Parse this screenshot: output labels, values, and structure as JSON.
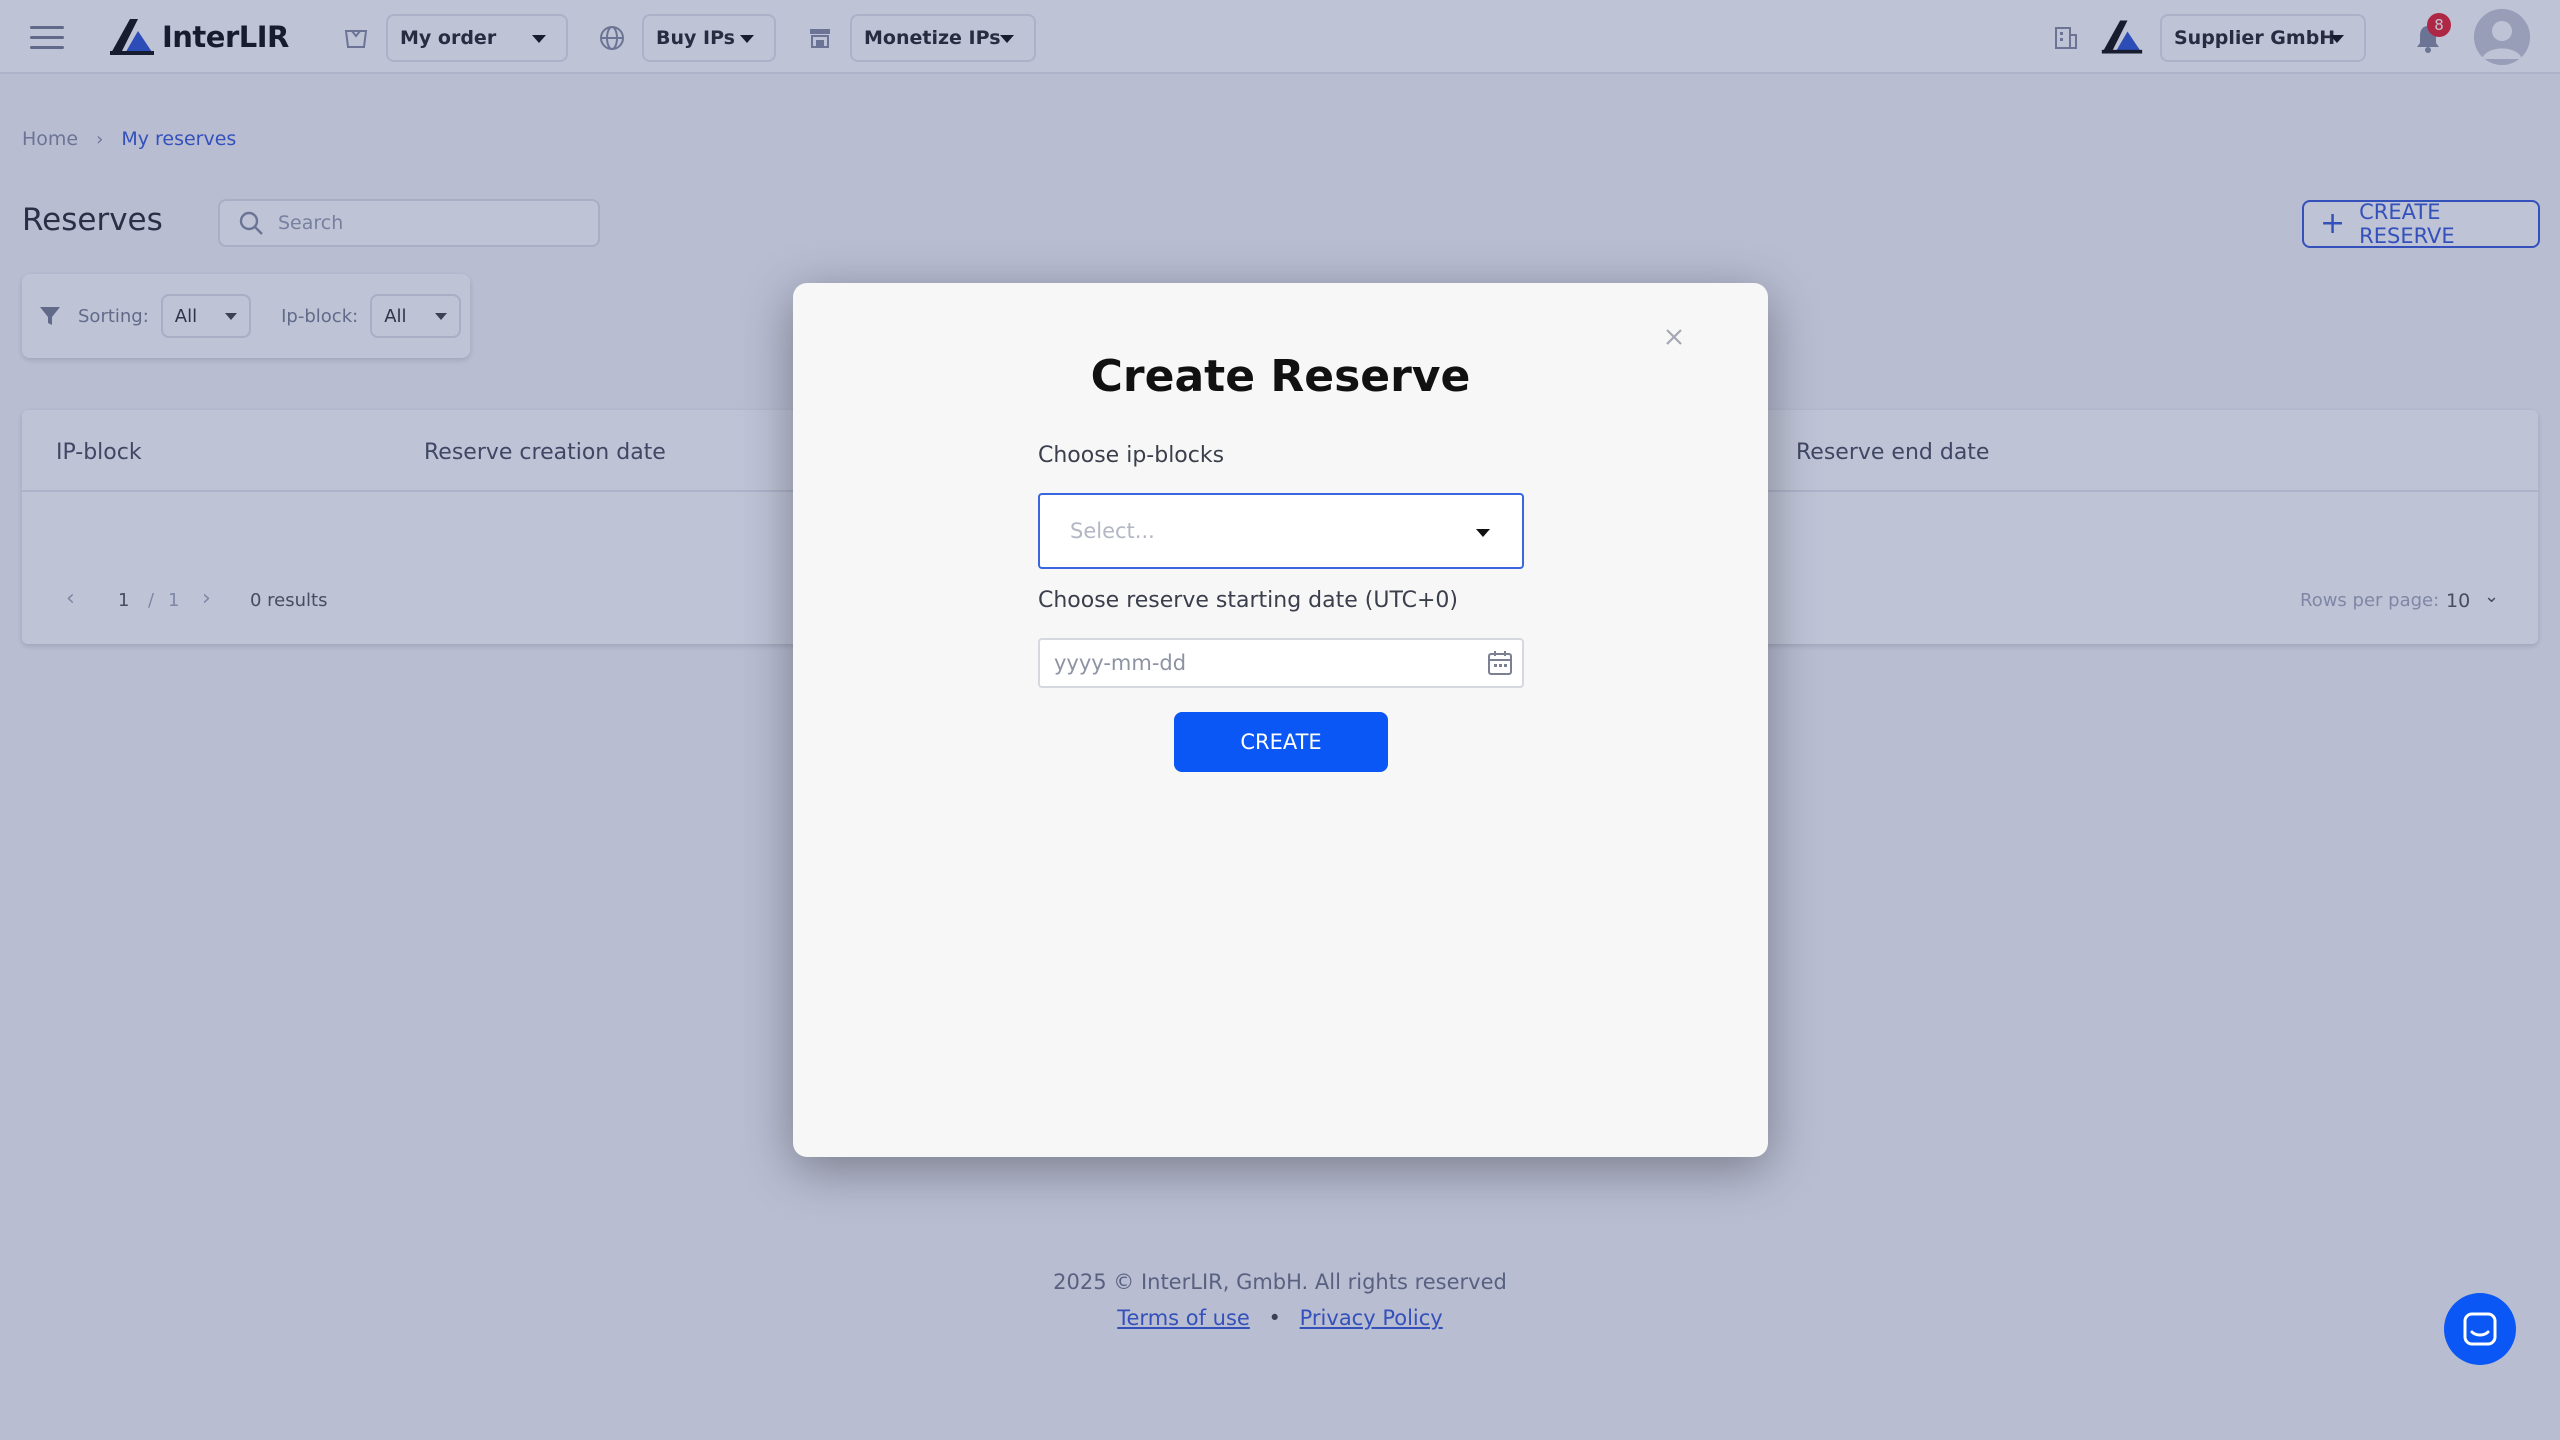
{
  "topbar": {
    "logo_text": "InterLIR",
    "nav": [
      {
        "label": "My order"
      },
      {
        "label": "Buy IPs"
      },
      {
        "label": "Monetize IPs"
      }
    ],
    "company": "Supplier GmbH",
    "notifications_count": "8"
  },
  "breadcrumb": {
    "home": "Home",
    "current": "My reserves"
  },
  "page": {
    "title": "Reserves",
    "search_placeholder": "Search",
    "create_button": "CREATE RESERVE",
    "filters": {
      "sorting_label": "Sorting:",
      "sorting_value": "All",
      "ipblock_label": "Ip-block:",
      "ipblock_value": "All"
    }
  },
  "table": {
    "columns": [
      "IP-block",
      "Reserve creation date",
      "Reserve end date"
    ],
    "pagination": {
      "current": "1",
      "sep": "/",
      "total": "1",
      "results": "0 results",
      "rows_per_page_label": "Rows per page:",
      "rows_per_page_value": "10"
    }
  },
  "modal": {
    "title": "Create Reserve",
    "ipblocks_label": "Choose ip-blocks",
    "ipblocks_placeholder": "Select...",
    "date_label": "Choose reserve starting date (UTC+0)",
    "date_placeholder": "yyyy-mm-dd",
    "submit": "CREATE"
  },
  "footer": {
    "copyright": "2025 © InterLIR, GmbH. All rights reserved",
    "terms": "Terms of use",
    "privacy": "Privacy Policy",
    "separator": "•"
  },
  "colors": {
    "accent": "#0a57f5",
    "link": "#3a5bd9",
    "badge": "#e8202e"
  }
}
